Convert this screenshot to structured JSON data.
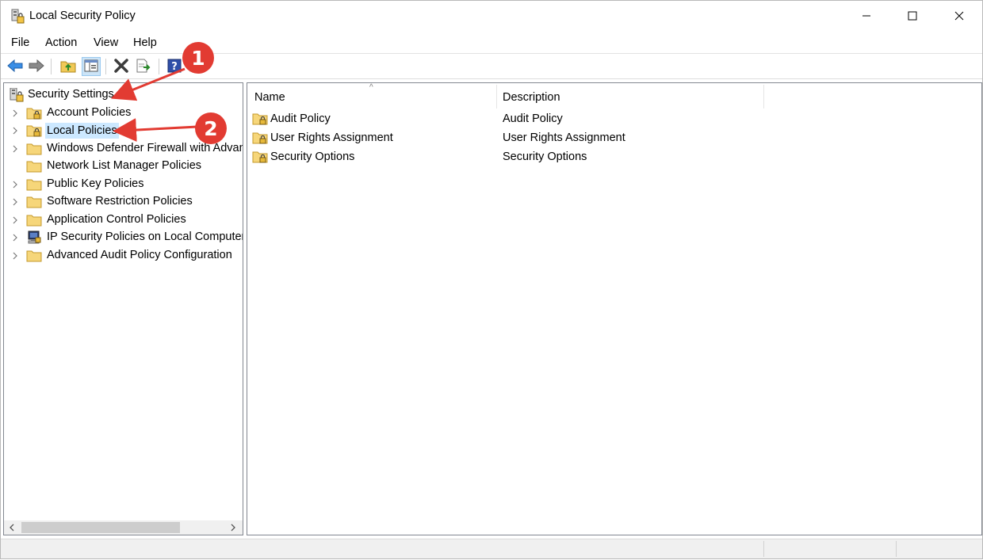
{
  "window": {
    "title": "Local Security Policy",
    "icons": {
      "app": "security-policy-icon",
      "minimize": "minimize-icon",
      "maximize": "maximize-icon",
      "close": "close-icon"
    }
  },
  "menu": {
    "file": "File",
    "action": "Action",
    "view": "View",
    "help": "Help"
  },
  "toolbar": {
    "buttons": [
      "back-icon",
      "forward-icon",
      "up-folder-icon",
      "show-hide-tree-icon",
      "delete-icon",
      "export-list-icon",
      "help-icon",
      "properties-icon"
    ],
    "pressed": "show-hide-tree-icon"
  },
  "tree": {
    "root": "Security Settings",
    "items": [
      {
        "label": "Account Policies",
        "icon": "locked-folder-icon",
        "expandable": true
      },
      {
        "label": "Local Policies",
        "icon": "locked-folder-icon",
        "expandable": true,
        "selected": true
      },
      {
        "label": "Windows Defender Firewall with Advan",
        "icon": "folder-icon",
        "expandable": true
      },
      {
        "label": "Network List Manager Policies",
        "icon": "folder-icon",
        "expandable": false
      },
      {
        "label": "Public Key Policies",
        "icon": "folder-icon",
        "expandable": true
      },
      {
        "label": "Software Restriction Policies",
        "icon": "folder-icon",
        "expandable": true
      },
      {
        "label": "Application Control Policies",
        "icon": "folder-icon",
        "expandable": true
      },
      {
        "label": "IP Security Policies on Local Computer",
        "icon": "ip-security-icon",
        "expandable": true
      },
      {
        "label": "Advanced Audit Policy Configuration",
        "icon": "folder-icon",
        "expandable": true
      }
    ]
  },
  "list": {
    "columns": [
      "Name",
      "Description"
    ],
    "rows": [
      {
        "name": "Audit Policy",
        "description": "Audit Policy"
      },
      {
        "name": "User Rights Assignment",
        "description": "User Rights Assignment"
      },
      {
        "name": "Security Options",
        "description": "Security Options"
      }
    ]
  },
  "annotations": {
    "badge1": "1",
    "badge2": "2",
    "color": "#e23b32"
  },
  "colors": {
    "selection": "#cce8ff",
    "toolbar_pressed": "#cce4f7",
    "pane_border": "#828790"
  }
}
